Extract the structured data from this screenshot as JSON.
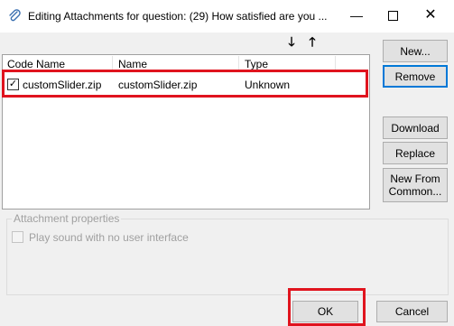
{
  "window": {
    "title": "Editing Attachments for question: (29) How satisfied are you ...",
    "minimize_glyph": "—",
    "close_glyph": "✕"
  },
  "icons": {
    "app": "paperclip-icon",
    "sort_down": "arrow-down-icon",
    "sort_up": "arrow-up-icon"
  },
  "sort_arrows": {
    "down": "🡓",
    "up": "🡑"
  },
  "list": {
    "columns": [
      "Code Name",
      "Name",
      "Type"
    ],
    "rows": [
      {
        "checked": true,
        "code_name": "customSlider.zip",
        "name": "customSlider.zip",
        "type": "Unknown"
      }
    ],
    "check_glyph": "✓"
  },
  "side_buttons": {
    "new": "New...",
    "remove": "Remove",
    "download": "Download",
    "replace": "Replace",
    "new_from_common": "New From Common..."
  },
  "properties": {
    "group_label": "Attachment properties",
    "play_sound_label": "Play sound with no user interface",
    "play_sound_checked": false
  },
  "footer": {
    "ok": "OK",
    "cancel": "Cancel"
  },
  "colors": {
    "highlight": "#e0141e",
    "default_button_border": "#0078d7"
  }
}
